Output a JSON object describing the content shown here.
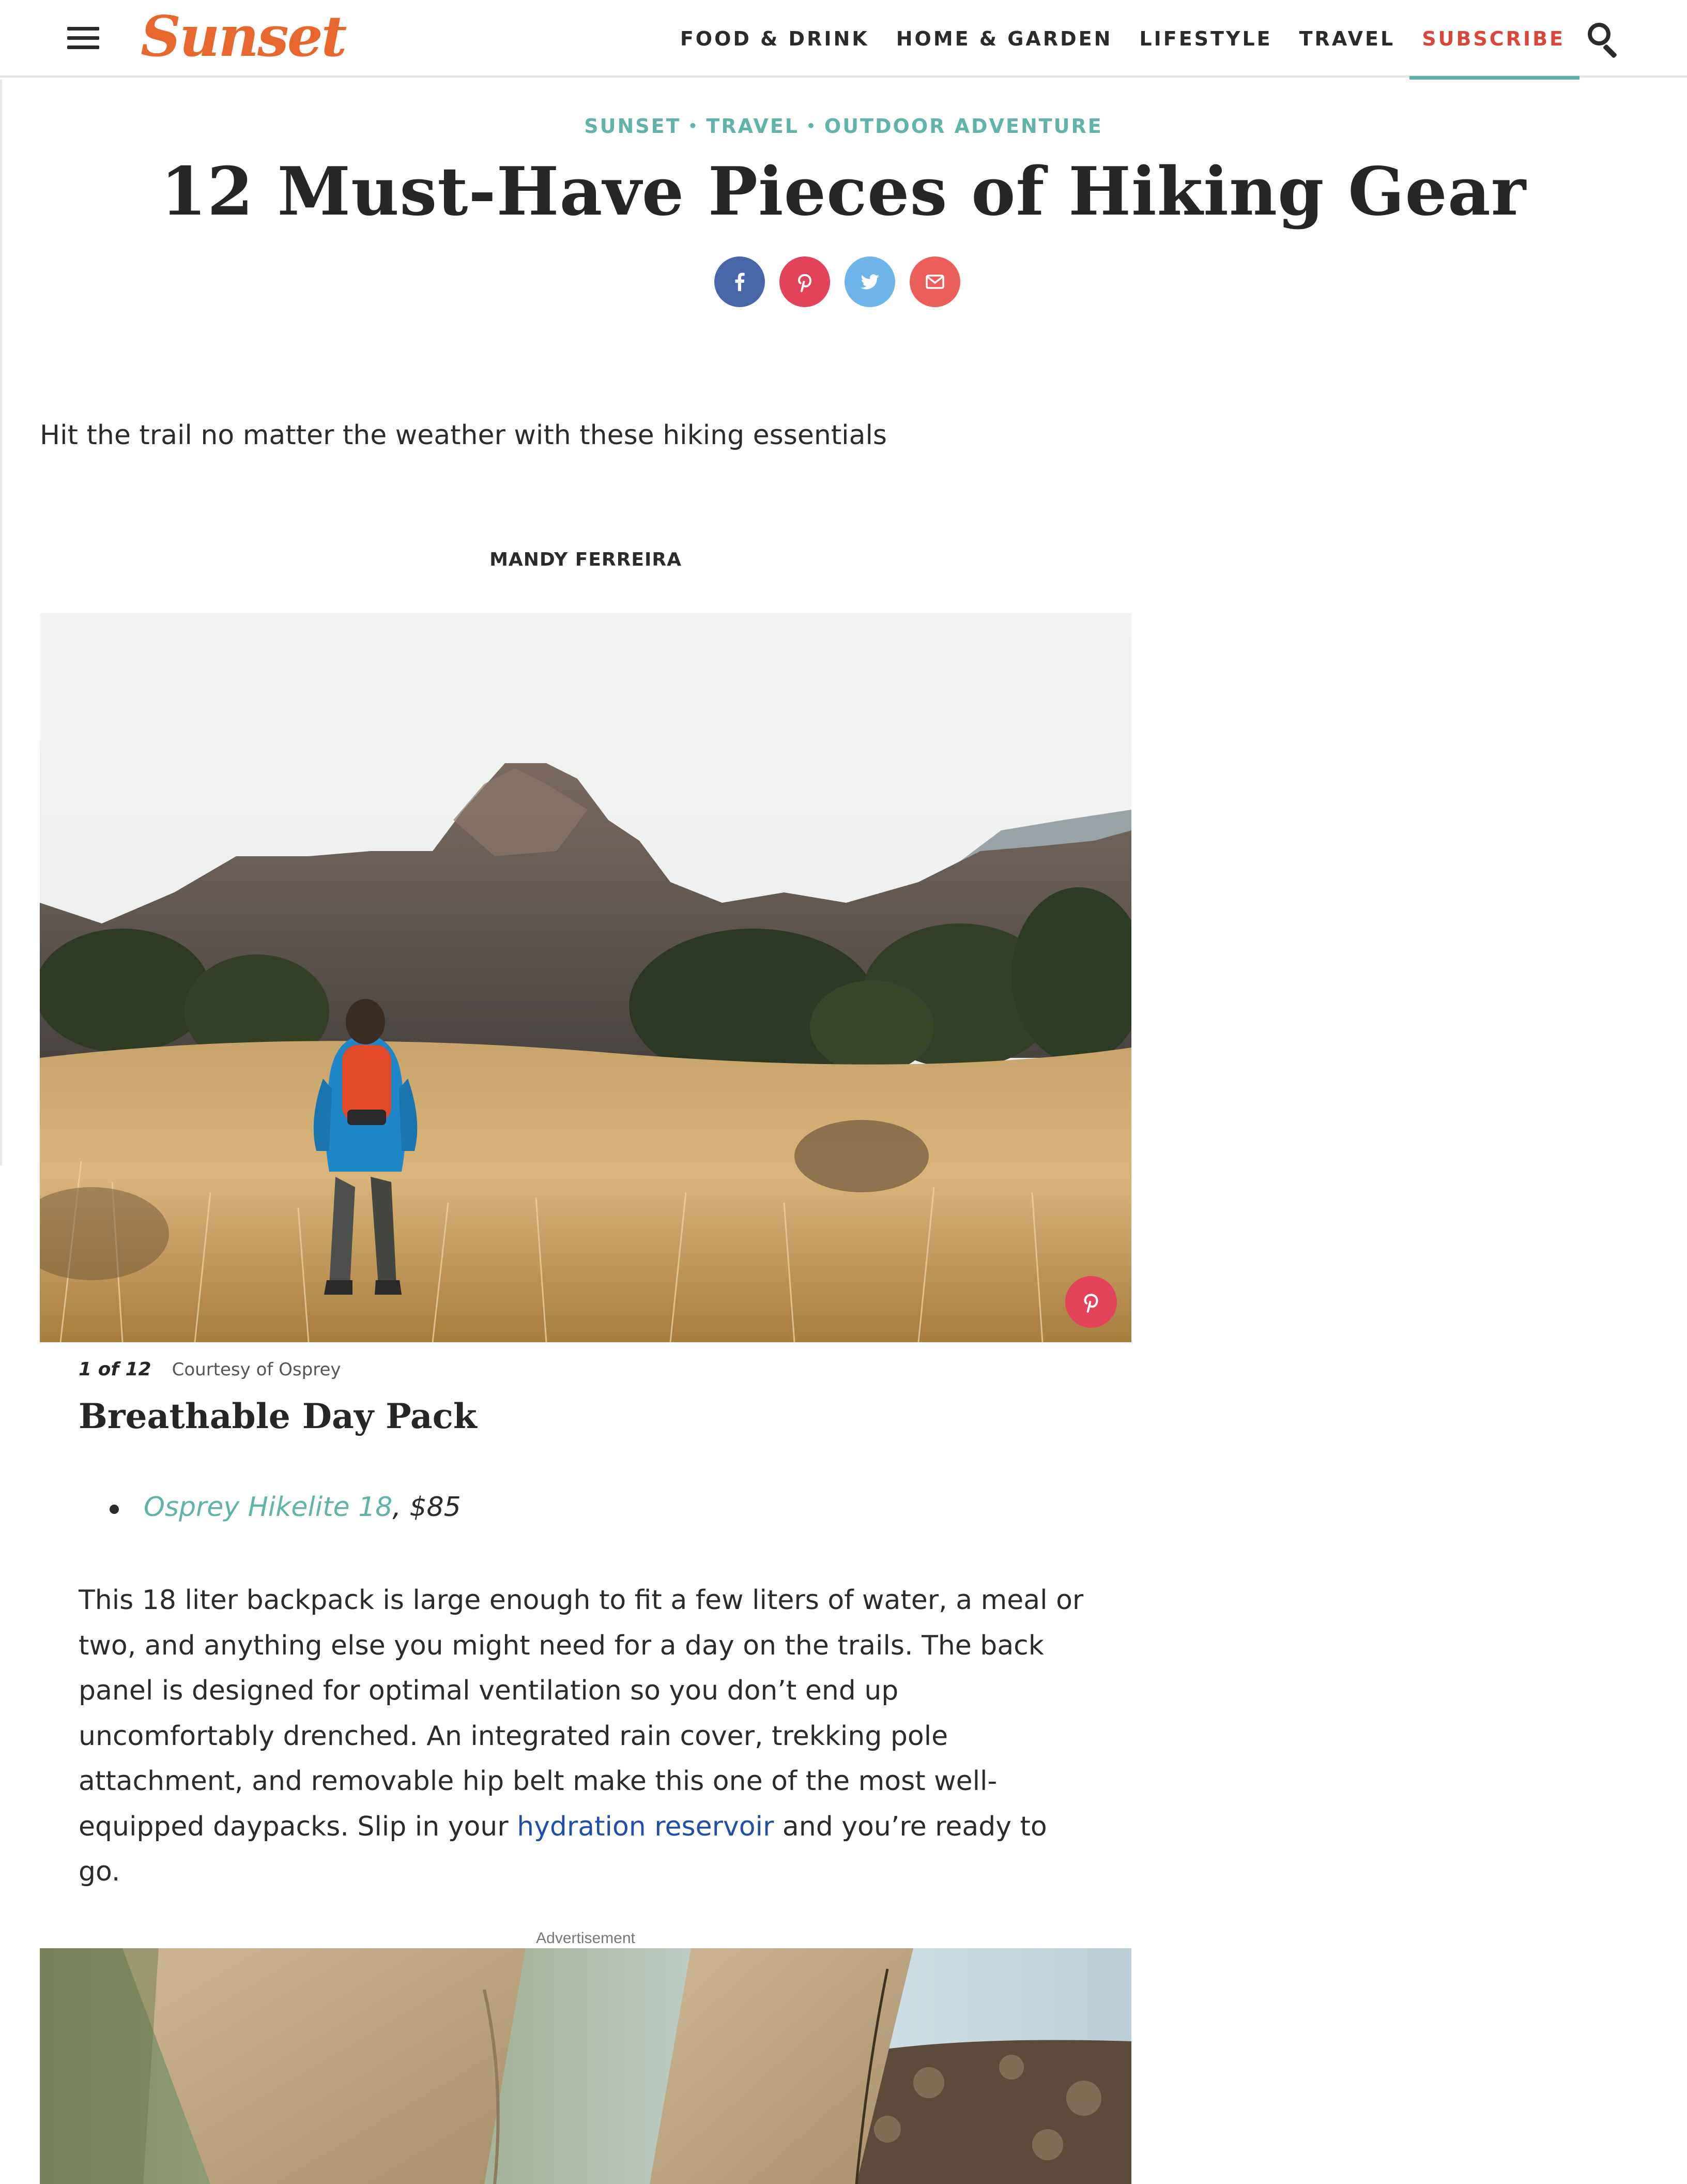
{
  "header": {
    "logo": "Sunset",
    "nav": [
      "FOOD & DRINK",
      "HOME & GARDEN",
      "LIFESTYLE",
      "TRAVEL"
    ],
    "subscribe": "SUBSCRIBE",
    "icons": {
      "menu": "hamburger-menu-icon",
      "search": "search-icon"
    }
  },
  "article": {
    "breadcrumb": [
      "SUNSET",
      "TRAVEL",
      "OUTDOOR ADVENTURE"
    ],
    "breadcrumb_separator": "•",
    "title": "12 Must-Have Pieces of Hiking Gear",
    "share_icons": [
      "facebook-icon",
      "pinterest-icon",
      "twitter-icon",
      "email-icon"
    ],
    "dek": "Hit the trail no matter the weather with these hiking essentials",
    "byline": "MANDY FERREIRA"
  },
  "slide": {
    "counter": "1 of 12",
    "credit": "Courtesy of Osprey",
    "title": "Breathable Day Pack",
    "product_name": "Osprey Hikelite 18",
    "product_price": ", $85",
    "body_before_link": "This 18 liter backpack is large enough to fit a few liters of water, a meal or two, and anything else you might need for a day on the trails. The back panel is designed for optimal ventilation so you don’t end up uncomfortably drenched. An integrated rain cover, trekking pole attachment, and removable hip belt make this one of the most well-equipped daypacks. Slip in your ",
    "body_link": "hydration reservoir",
    "body_after_link": " and you’re ready to go."
  },
  "advertisement_label": "Advertisement",
  "colors": {
    "brand": "#e8672f",
    "accent": "#5fb3a9",
    "subscribe": "#d9473a",
    "facebook": "#4867aa",
    "pinterest": "#e2435a",
    "twitter": "#6db4ea",
    "email": "#ec5e5a",
    "body_link": "#1f4fa8"
  }
}
